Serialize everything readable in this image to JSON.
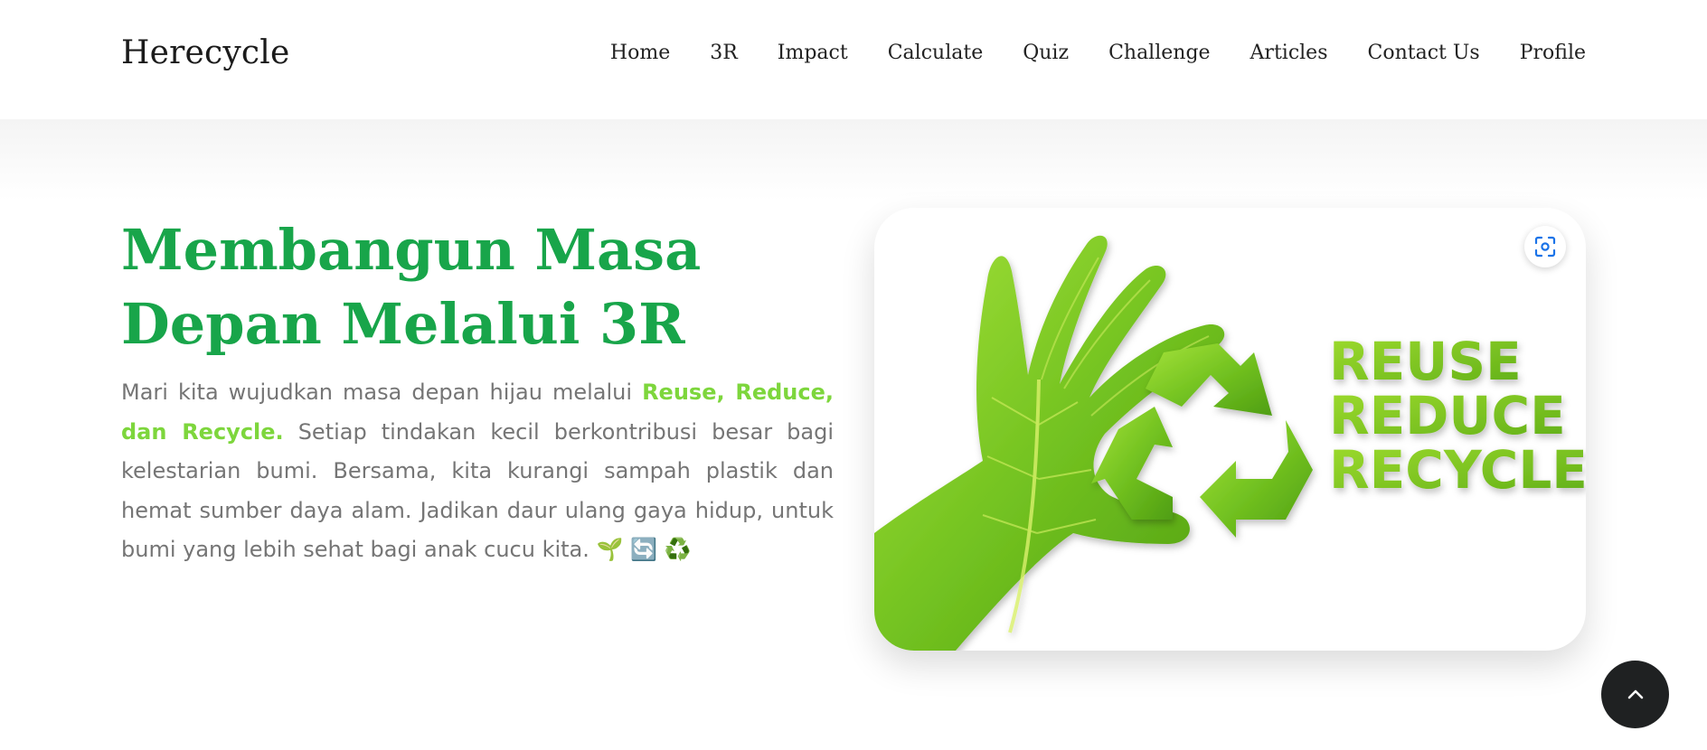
{
  "header": {
    "brand": "Herecycle",
    "nav": [
      "Home",
      "3R",
      "Impact",
      "Calculate",
      "Quiz",
      "Challenge",
      "Articles",
      "Contact Us",
      "Profile"
    ]
  },
  "hero": {
    "title_line1": "Membangun Masa",
    "title_line2": "Depan Melalui 3R",
    "text_intro": "Mari kita wujudkan masa depan hijau melalui ",
    "text_highlight": "Reuse, Reduce, dan Recycle.",
    "text_body": " Setiap tindakan kecil berkontribusi besar bagi kelestarian bumi. Bersama, kita kurangi sampah plastik dan hemat sumber daya alam. Jadikan daur ulang gaya hidup, untuk bumi yang lebih sehat bagi anak cucu kita. ",
    "emojis": [
      "🌱",
      "🔄",
      "♻️"
    ],
    "image_words": [
      "REUSE",
      "REDUCE",
      "RECYCLE"
    ]
  },
  "icons": {
    "lens": "google-lens-icon",
    "back_to_top": "chevron-up-icon"
  },
  "colors": {
    "title_green": "#18a54a",
    "highlight_green": "#7dd63c",
    "leaf_green": "#7cc826",
    "body_gray": "#757575",
    "dark_button": "#1f2122",
    "lens_blue": "#1a73e8"
  }
}
